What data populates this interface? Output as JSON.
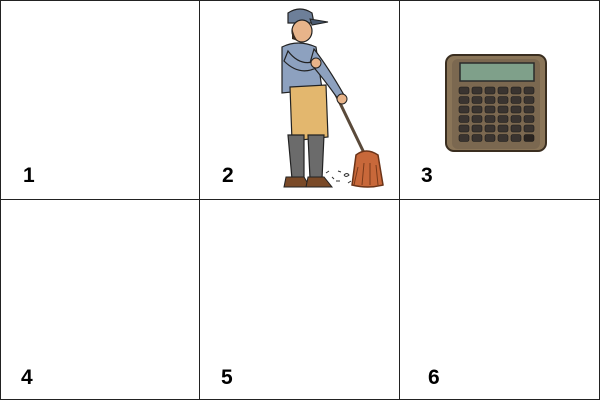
{
  "grid": {
    "cells": [
      {
        "number": "1"
      },
      {
        "number": "2",
        "image": "sweeper-icon"
      },
      {
        "number": "3",
        "image": "calculator-icon"
      },
      {
        "number": "4"
      },
      {
        "number": "5"
      },
      {
        "number": "6"
      }
    ]
  }
}
